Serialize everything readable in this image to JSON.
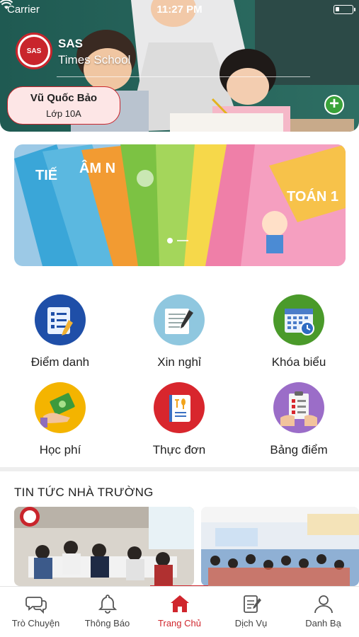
{
  "status_bar": {
    "carrier": "Carrier",
    "time": "11:27 PM"
  },
  "school": {
    "code": "SAS",
    "name": "Times School",
    "logo_text": "SAS"
  },
  "student": {
    "name": "Vũ Quốc Bảo",
    "class": "Lớp 10A"
  },
  "add_button": "+",
  "banner": {
    "books": [
      "TIẾ",
      "ÂM N",
      "TOÁN 1"
    ],
    "slide_count": 2,
    "active_slide": 1
  },
  "menu": [
    {
      "label": "Điểm danh",
      "icon": "attendance-icon",
      "color": "#1f4fa8"
    },
    {
      "label": "Xin nghỉ",
      "icon": "leave-request-icon",
      "color": "#8fc7df"
    },
    {
      "label": "Khóa biểu",
      "icon": "timetable-icon",
      "color": "#4a9a2a"
    },
    {
      "label": "Học phí",
      "icon": "tuition-icon",
      "color": "#f4b400"
    },
    {
      "label": "Thực đơn",
      "icon": "menu-food-icon",
      "color": "#d8262d"
    },
    {
      "label": "Bảng điểm",
      "icon": "grades-icon",
      "color": "#9b6dc8"
    }
  ],
  "news": {
    "title": "TIN TỨC NHÀ TRƯỜNG"
  },
  "tabs": [
    {
      "label": "Trò Chuyện",
      "icon": "chat-icon"
    },
    {
      "label": "Thông Báo",
      "icon": "bell-icon"
    },
    {
      "label": "Trang Chủ",
      "icon": "home-icon",
      "active": true
    },
    {
      "label": "Dịch Vụ",
      "icon": "service-icon"
    },
    {
      "label": "Danh Bạ",
      "icon": "contacts-icon"
    }
  ],
  "colors": {
    "accent": "#d0262d",
    "add_green": "#3aa33a"
  }
}
